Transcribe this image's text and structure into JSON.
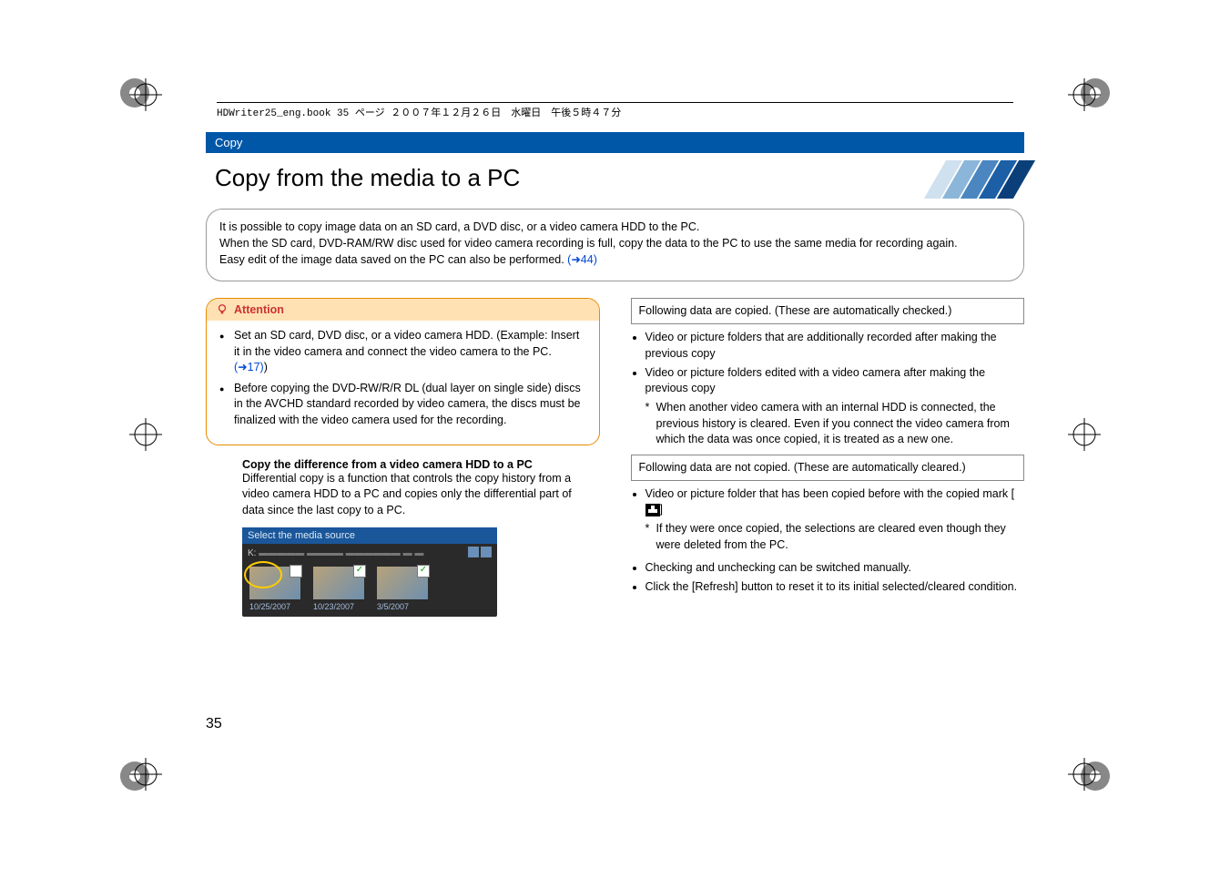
{
  "header_line": "HDWriter25_eng.book  35 ページ  ２００７年１２月２６日　水曜日　午後５時４７分",
  "section_tag": "Copy",
  "title": "Copy from the media to a PC",
  "intro": {
    "l1": "It is possible to copy image data on an SD card, a DVD disc, or a video camera HDD to the PC.",
    "l2": "When the SD card, DVD-RAM/RW disc used for video camera recording is full, copy the data to the PC to use the same media for recording again.",
    "l3a": "Easy edit of the image data saved on the PC can also be performed. ",
    "l3link": "(➜44)"
  },
  "attention": {
    "head": "Attention",
    "b1a": "Set an SD card, DVD disc, or a video camera HDD. (Example: Insert it in the video camera and connect the video camera to the PC. ",
    "b1link": "(➜17)",
    "b1b": ")",
    "b2": "Before copying the DVD-RW/R/R DL (dual layer on single side) discs in the AVCHD standard recorded by video camera, the discs must be finalized with the video camera used for the recording."
  },
  "section_copy_diff": {
    "head": "Copy the difference from a video camera HDD to a PC",
    "body": "Differential copy is a function that controls the copy history from a video camera HDD to a PC and copies only the differential part of data since the last copy to a PC."
  },
  "figure": {
    "title": "Select the media source",
    "drive": "K:",
    "drive_rest": "▬▬▬▬▬ ▬▬▬▬  ▬▬▬▬▬▬ ▬ ▬",
    "dates": [
      "10/25/2007",
      "10/23/2007",
      "3/5/2007"
    ]
  },
  "right": {
    "box1": "Following data are copied. (These are automatically checked.)",
    "r1a": "Video or picture folders that are additionally recorded after making the previous copy",
    "r1b": "Video or picture folders edited with a video camera after making the previous copy",
    "star1": "When another video camera with an internal HDD is connected, the previous history is cleared. Even if you connect the video camera from which the data was once copied, it is treated as a new one.",
    "box2": "Following data are not copied. (These are automatically cleared.)",
    "r2a_pre": "Video or picture folder that has been copied before with the copied mark [",
    "r2a_post": "]",
    "star2": "If they were once copied, the selections are cleared even though they were deleted from the PC.",
    "b3": "Checking and unchecking can be switched manually.",
    "b4": "Click the [Refresh] button to reset it to its initial selected/cleared condition."
  },
  "page_number": "35"
}
